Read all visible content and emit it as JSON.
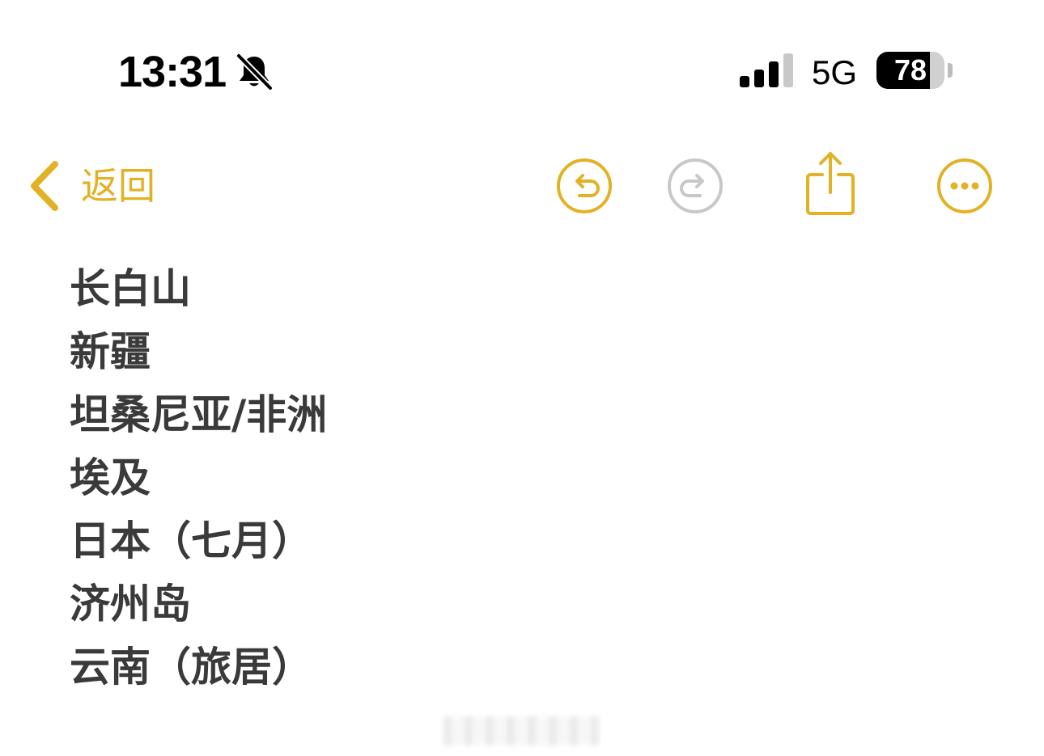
{
  "status_bar": {
    "time": "13:31",
    "network": "5G",
    "battery_percent": "78",
    "battery_level": 0.78,
    "silent_mode": true,
    "icons": [
      "bell-slash-icon",
      "signal-icon",
      "battery-icon"
    ]
  },
  "nav": {
    "back_label": "返回",
    "icons": [
      "chevron-left-icon",
      "undo-icon",
      "redo-icon",
      "share-icon",
      "more-icon"
    ],
    "undo_enabled": true,
    "redo_enabled": false
  },
  "note": {
    "lines": [
      "长白山",
      "新疆",
      "坦桑尼亚/非洲",
      "埃及",
      "日本（七月）",
      "济州岛",
      "云南（旅居）"
    ]
  },
  "colors": {
    "accent": "#E1B226",
    "disabled": "#C8C8C8",
    "text": "#3A3A3A",
    "background": "#FFFFFF"
  }
}
